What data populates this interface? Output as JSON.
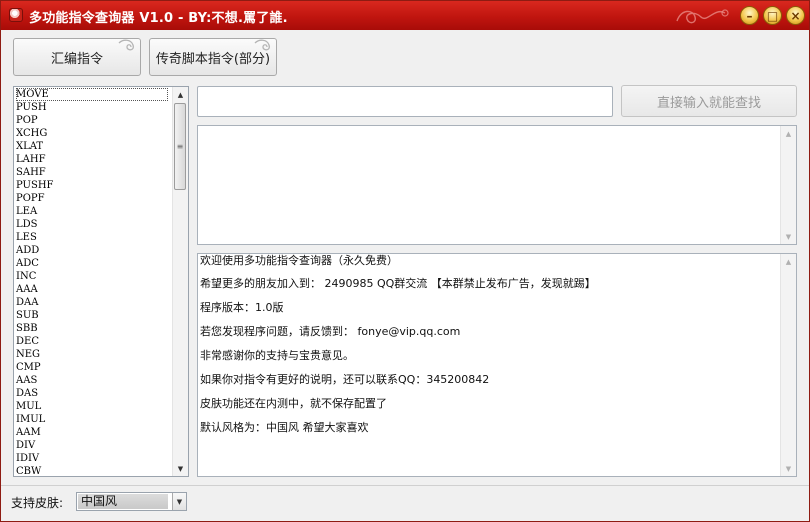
{
  "window": {
    "title": "多功能指令查询器 V1.0  -  BY:不想.罵了誰.",
    "accent_color": "#c0150f"
  },
  "toolbar": {
    "asm_label": "汇编指令",
    "legend_label": "传奇脚本指令(部分)"
  },
  "instructions": [
    "MOVE",
    "PUSH",
    "POP",
    "XCHG",
    "XLAT",
    "LAHF",
    "SAHF",
    "PUSHF",
    "POPF",
    "LEA",
    "LDS",
    "LES",
    "ADD",
    "ADC",
    "INC",
    "AAA",
    "DAA",
    "SUB",
    "SBB",
    "DEC",
    "NEG",
    "CMP",
    "AAS",
    "DAS",
    "MUL",
    "IMUL",
    "AAM",
    "DIV",
    "IDIV",
    "CBW"
  ],
  "selected_instruction": "MOVE",
  "search": {
    "value": "",
    "button_label": "直接输入就能查找"
  },
  "info_lines": [
    "欢迎使用多功能指令查询器（永久免费）",
    "希望更多的朋友加入到：  2490985  QQ群交流 【本群禁止发布广告，发现就踢】",
    "程序版本：1.0版",
    "若您发现程序问题，请反馈到： fonye@vip.qq.com",
    "非常感谢你的支持与宝贵意见。",
    "如果你对指令有更好的说明，还可以联系QQ：345200842",
    "皮肤功能还在内测中，就不保存配置了",
    "默认风格为：中国风 希望大家喜欢"
  ],
  "status": {
    "skin_label": "支持皮肤:",
    "skin_value": "中国风"
  },
  "icons": {
    "minimize": "minimize-icon",
    "maximize": "maximize-icon",
    "close": "close-icon",
    "scroll_up": "arrow-up-icon",
    "scroll_down": "arrow-down-icon",
    "dropdown": "chevron-down-icon"
  }
}
